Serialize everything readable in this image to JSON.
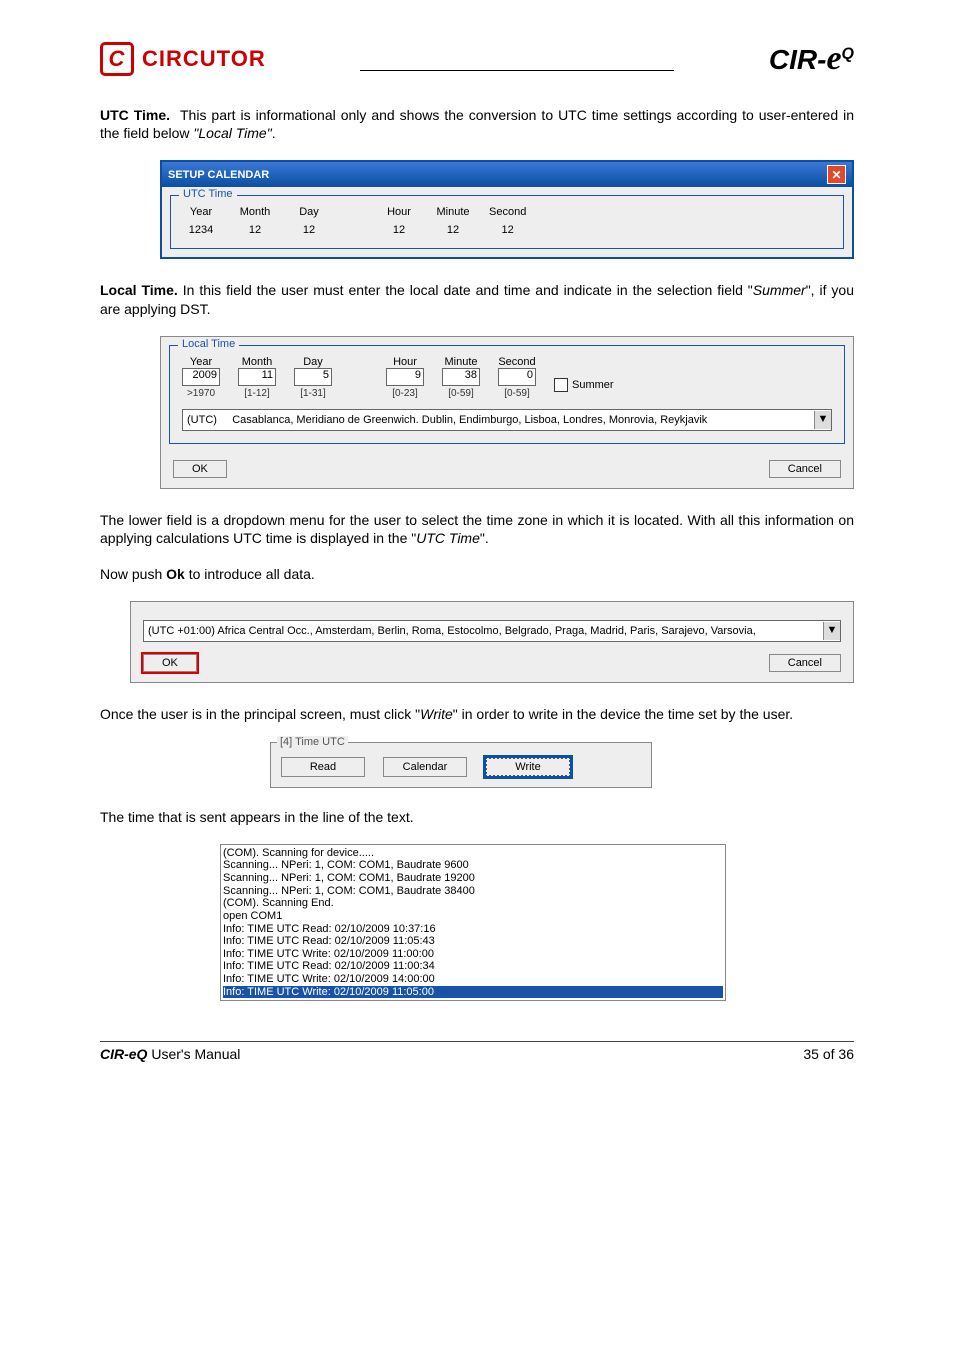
{
  "header": {
    "brand": "CIRCUTOR",
    "model_prefix": "CIR-",
    "model_script": "e",
    "model_sup": "Q"
  },
  "p1": {
    "label": "UTC Time.",
    "text": "This part is informational only and shows the conversion to UTC time settings according to user-entered in the field below ",
    "italic": "\"Local Time\"",
    "tail": "."
  },
  "win1": {
    "title": "SETUP CALENDAR"
  },
  "cols": {
    "year": "Year",
    "month": "Month",
    "day": "Day",
    "hour": "Hour",
    "minute": "Minute",
    "second": "Second"
  },
  "utc_legend": "UTC Time",
  "utc_vals": {
    "year": "1234",
    "month": "12",
    "day": "12",
    "hour": "12",
    "minute": "12",
    "second": "12"
  },
  "p2": {
    "label": "Local Time.",
    "text": " In this field the user must enter the local date and time and indicate in the selection field \"",
    "italic": "Summer",
    "tail": "\", if you are applying DST."
  },
  "local_legend": "Local Time",
  "local_vals": {
    "year": "2009",
    "month": "11",
    "day": "5",
    "hour": "9",
    "minute": "38",
    "second": "0"
  },
  "hints": {
    "year": ">1970",
    "month": "[1-12]",
    "day": "[1-31]",
    "hour": "[0-23]",
    "minute": "[0-59]",
    "second": "[0-59]"
  },
  "summer_label": "Summer",
  "tz1_prefix": "(UTC)",
  "tz1_text": "Casablanca, Meridiano de Greenwich. Dublin, Endimburgo, Lisboa, Londres, Monrovia, Reykjavik",
  "ok": "OK",
  "cancel": "Cancel",
  "p3a": "The lower field is a dropdown menu for the user to select the time zone in which it is located. With all this information on applying calculations UTC time is displayed in the \"",
  "p3i": "UTC Time",
  "p3b": "\".",
  "p4a": "Now push ",
  "p4b": "Ok",
  "p4c": " to introduce all data.",
  "tz2": "(UTC +01:00) Africa Central Occ., Amsterdam, Berlin, Roma, Estocolmo, Belgrado, Praga, Madrid, Paris, Sarajevo, Varsovia,",
  "p5a": "Once the user is in the principal screen, must click \"",
  "p5i": "Write",
  "p5b": "\" in order to write in the device the time set by the user.",
  "small_legend": "[4] Time UTC",
  "buttons": {
    "read": "Read",
    "calendar": "Calendar",
    "write": "Write"
  },
  "p6": "The time that is sent appears in the line of the text.",
  "log": [
    "(COM). Scanning for device.....",
    "Scanning...  NPeri: 1, COM: COM1, Baudrate 9600",
    "Scanning...  NPeri: 1, COM: COM1, Baudrate 19200",
    "Scanning...  NPeri: 1, COM: COM1, Baudrate 38400",
    "(COM). Scanning End.",
    "open COM1",
    "Info: TIME UTC Read: 02/10/2009 10:37:16",
    "Info: TIME UTC Read: 02/10/2009 11:05:43",
    "Info: TIME UTC Write: 02/10/2009 11:00:00",
    "Info: TIME UTC Read: 02/10/2009 11:00:34",
    "Info: TIME UTC Write: 02/10/2009 14:00:00",
    "Info: TIME UTC Write: 02/10/2009 11:05:00"
  ],
  "footer": {
    "left_bold": "CIR-eQ",
    "left_rest": " User's Manual",
    "right": "35 of 36"
  }
}
